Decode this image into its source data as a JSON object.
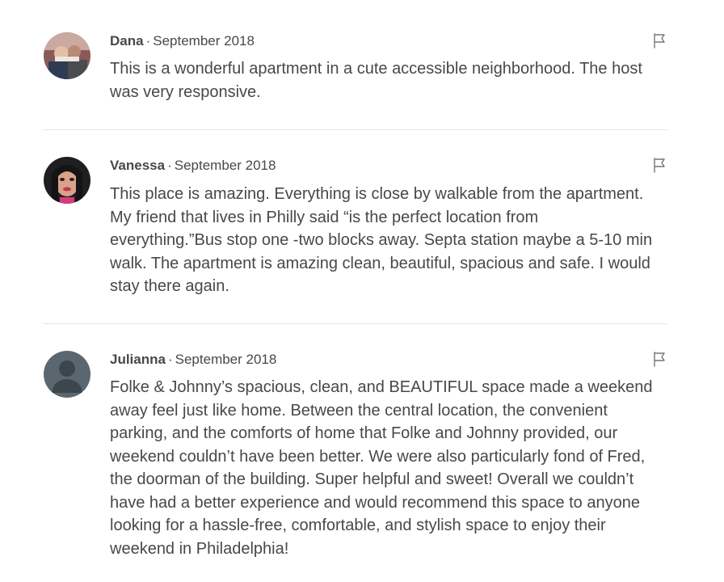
{
  "reviews": [
    {
      "author": "Dana",
      "separator": "·",
      "date": "September 2018",
      "text": "This is a wonderful apartment in a cute accessible neighborhood. The host was very responsive."
    },
    {
      "author": "Vanessa",
      "separator": "·",
      "date": "September 2018",
      "text": "This place is amazing. Everything is close by walkable from the apartment. My friend that lives in Philly said “is the perfect location from everything.”Bus stop one -two blocks away. Septa station maybe a 5-10 min walk. The apartment is amazing clean, beautiful, spacious and safe. I would stay there again."
    },
    {
      "author": "Julianna",
      "separator": "·",
      "date": "September 2018",
      "text": "Folke & Johnny’s spacious, clean, and BEAUTIFUL space made a weekend away feel just like home. Between the central location, the convenient parking, and the comforts of home that Folke and Johnny provided, our weekend couldn’t have been better. We were also particularly fond of Fred, the doorman of the building. Super helpful and sweet! Overall we couldn’t have had a better experience and would recommend this space to anyone looking for a hassle-free, comfortable, and stylish space to enjoy their weekend in Philadelphia!"
    }
  ],
  "icons": {
    "flag": "flag-icon",
    "avatar_default": "default-user-icon"
  },
  "colors": {
    "text": "#484848",
    "divider": "#e4e4e4",
    "flag": "#767676",
    "default_avatar": "#5b6770"
  }
}
